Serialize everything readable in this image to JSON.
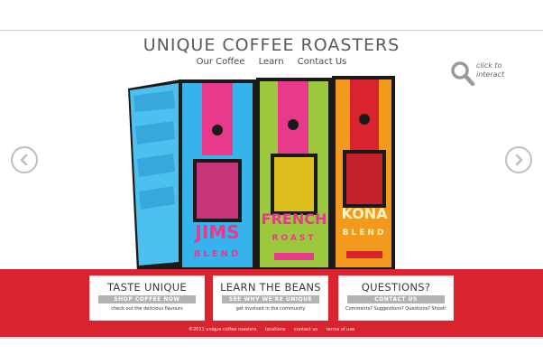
{
  "brand": {
    "title": "UNIQUE COFFEE ROASTERS"
  },
  "nav": {
    "items": [
      "Our Coffee",
      "Learn",
      "Contact Us"
    ]
  },
  "hint": {
    "line1": "click to",
    "line2": "interact",
    "icon": "search-icon"
  },
  "carousel": {
    "prev_icon": "chevron-left-icon",
    "next_icon": "chevron-right-icon"
  },
  "products": [
    {
      "name_line1": "JIMS",
      "name_line2": "BLEND",
      "color": "#22a7e0"
    },
    {
      "name_line1": "FRENCH",
      "name_line2": "ROAST",
      "color": "#9bc83c"
    },
    {
      "name_line1": "KONA",
      "name_line2": "BLEND",
      "color": "#f39a1e"
    }
  ],
  "cards": [
    {
      "title": "TASTE UNIQUE",
      "button": "SHOP COFFEE NOW",
      "subtitle": "check out the delicious flavours"
    },
    {
      "title": "LEARN THE BEANS",
      "button": "SEE WHY WE'RE UNIQUE",
      "subtitle": "get involved in the community"
    },
    {
      "title": "QUESTIONS?",
      "button": "CONTACT US",
      "subtitle": "Comments? Suggestions? Questions? Shoot!"
    }
  ],
  "footer": {
    "copyright": "©2011 unique coffee roasters",
    "links": [
      "locations",
      "contact us",
      "terms of use"
    ]
  },
  "colors": {
    "accent_red": "#d9232e",
    "button_gray": "#b3b3b3"
  }
}
